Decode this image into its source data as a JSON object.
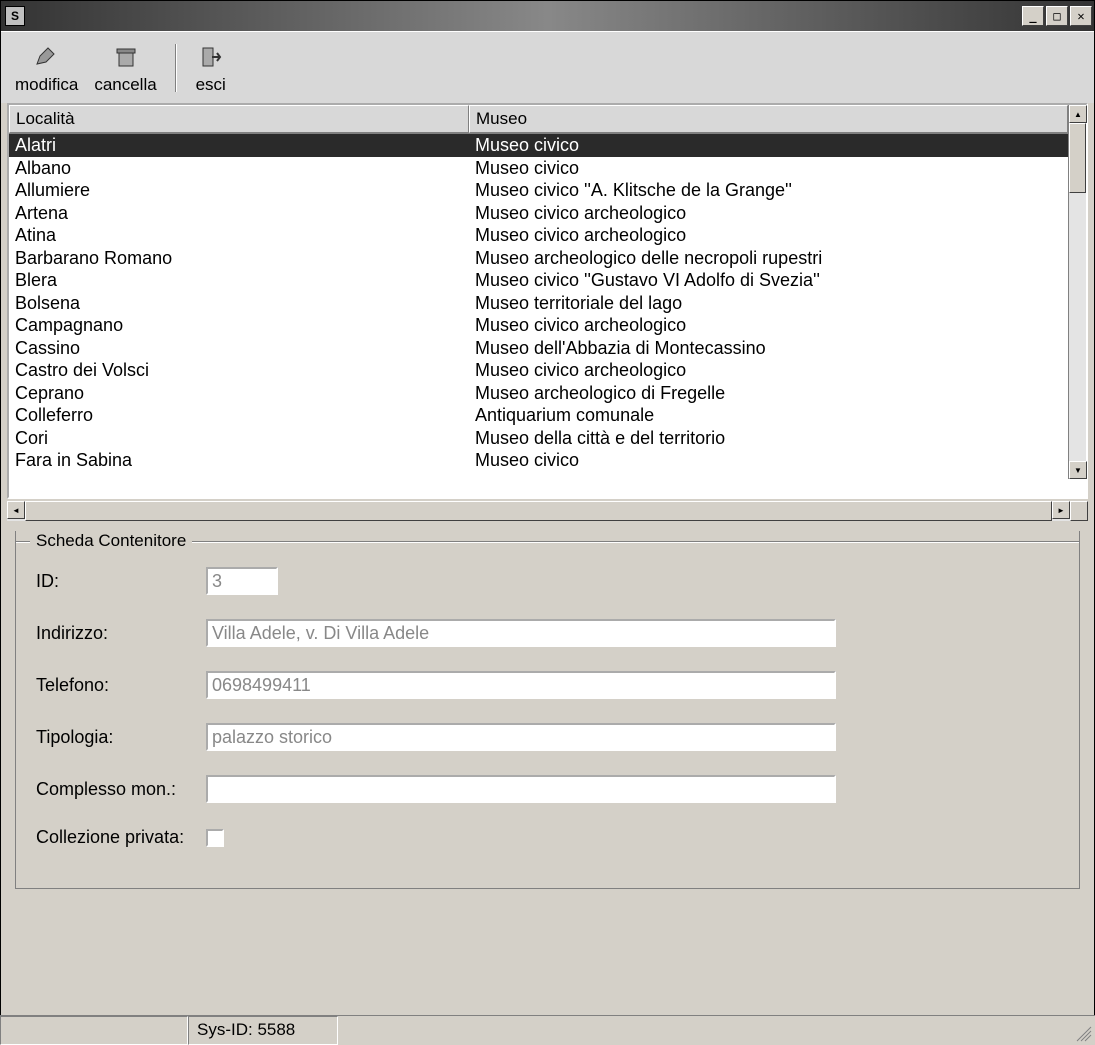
{
  "titlebar": {
    "title": ""
  },
  "toolbar": {
    "modifica": "modifica",
    "cancella": "cancella",
    "esci": "esci"
  },
  "grid": {
    "columns": [
      "Località",
      "Museo"
    ],
    "rows": [
      {
        "localita": "Alatri",
        "museo": "Museo civico",
        "selected": true
      },
      {
        "localita": "Albano",
        "museo": "Museo civico"
      },
      {
        "localita": "Allumiere",
        "museo": "Museo civico ''A. Klitsche de la Grange''"
      },
      {
        "localita": "Artena",
        "museo": "Museo civico archeologico"
      },
      {
        "localita": "Atina",
        "museo": "Museo civico archeologico"
      },
      {
        "localita": "Barbarano Romano",
        "museo": "Museo archeologico delle necropoli rupestri"
      },
      {
        "localita": "Blera",
        "museo": "Museo civico ''Gustavo VI Adolfo di Svezia''"
      },
      {
        "localita": "Bolsena",
        "museo": "Museo territoriale del lago"
      },
      {
        "localita": "Campagnano",
        "museo": "Museo civico archeologico"
      },
      {
        "localita": "Cassino",
        "museo": "Museo dell'Abbazia di Montecassino"
      },
      {
        "localita": "Castro dei Volsci",
        "museo": "Museo civico archeologico"
      },
      {
        "localita": "Ceprano",
        "museo": "Museo archeologico di Fregelle"
      },
      {
        "localita": "Colleferro",
        "museo": "Antiquarium comunale"
      },
      {
        "localita": "Cori",
        "museo": "Museo della città e del territorio"
      },
      {
        "localita": "Fara in Sabina",
        "museo": "Museo civico"
      }
    ]
  },
  "form": {
    "legend": "Scheda Contenitore",
    "labels": {
      "id": "ID:",
      "indirizzo": "Indirizzo:",
      "telefono": "Telefono:",
      "tipologia": "Tipologia:",
      "complesso": "Complesso mon.:",
      "collezione": "Collezione privata:"
    },
    "values": {
      "id": "3",
      "indirizzo": "Villa Adele, v. Di Villa Adele",
      "telefono": "0698499411",
      "tipologia": "palazzo storico",
      "complesso": "",
      "collezione": false
    }
  },
  "statusbar": {
    "sysid": "Sys-ID: 5588"
  }
}
